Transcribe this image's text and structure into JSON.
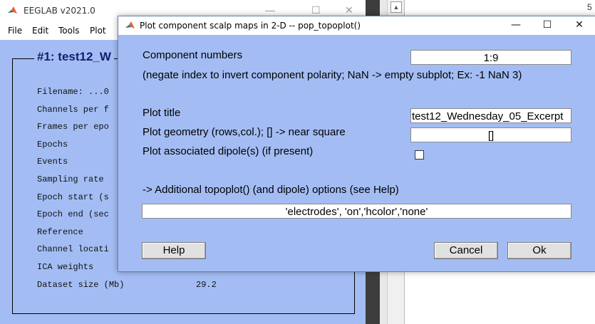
{
  "background_window": {
    "title": "EEGLAB v2021.0",
    "controls": [
      "—",
      "☐",
      "✕"
    ],
    "menu": [
      "File",
      "Edit",
      "Tools",
      "Plot"
    ],
    "dataset_title": "#1: test12_W",
    "info_rows": [
      {
        "label": "Filename: ...0",
        "value": ""
      },
      {
        "label": "Channels per f",
        "value": ""
      },
      {
        "label": "Frames per epo",
        "value": ""
      },
      {
        "label": "Epochs",
        "value": ""
      },
      {
        "label": "Events",
        "value": ""
      },
      {
        "label": "Sampling rate",
        "value": ""
      },
      {
        "label": "Epoch start (s",
        "value": ""
      },
      {
        "label": "Epoch end (sec",
        "value": ""
      },
      {
        "label": "Reference",
        "value": ""
      },
      {
        "label": "Channel locati",
        "value": ""
      },
      {
        "label": "ICA weights",
        "value": ""
      },
      {
        "label": "Dataset size (Mb)",
        "value": "29.2"
      }
    ],
    "right_edge_text": "5"
  },
  "dialog": {
    "title": "Plot component scalp maps in 2-D -- pop_topoplot()",
    "controls": {
      "minimize": "—",
      "maximize": "☐",
      "close": "✕"
    },
    "component_numbers_label": "Component numbers",
    "component_numbers_value": "1:9",
    "component_hint": "(negate index to invert component polarity; NaN -> empty subplot; Ex: -1 NaN 3)",
    "plot_title_label": "Plot title",
    "plot_title_value": "test12_Wednesday_05_Excerpt",
    "plot_geometry_label": "Plot geometry (rows,col.); [] -> near square",
    "plot_geometry_value": "[]",
    "dipole_label": "Plot associated dipole(s) (if present)",
    "dipole_checked": false,
    "options_label": "-> Additional topoplot() (and dipole) options (see Help)",
    "options_value": "'electrodes', 'on','hcolor','none'",
    "help_button": "Help",
    "cancel_button": "Cancel",
    "ok_button": "Ok"
  },
  "colors": {
    "dialog_bg": "#a3bdf4",
    "dataset_title": "#0f1f6e"
  }
}
